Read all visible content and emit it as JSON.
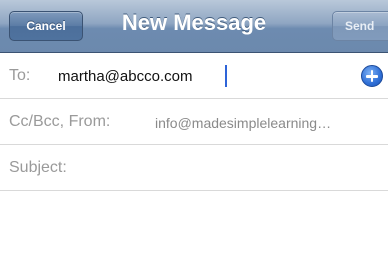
{
  "navbar": {
    "title": "New Message",
    "cancel_label": "Cancel",
    "send_label": "Send"
  },
  "to_row": {
    "label": "To:",
    "value": "martha@abcco.com",
    "add_icon": "plus-circle-icon"
  },
  "cc_row": {
    "label": "Cc/Bcc, From:",
    "value": "info@madesimplelearning…"
  },
  "subject_row": {
    "label": "Subject:",
    "value": ""
  },
  "colors": {
    "navbar": "#6d8bb0",
    "accent": "#2f6fd6"
  }
}
